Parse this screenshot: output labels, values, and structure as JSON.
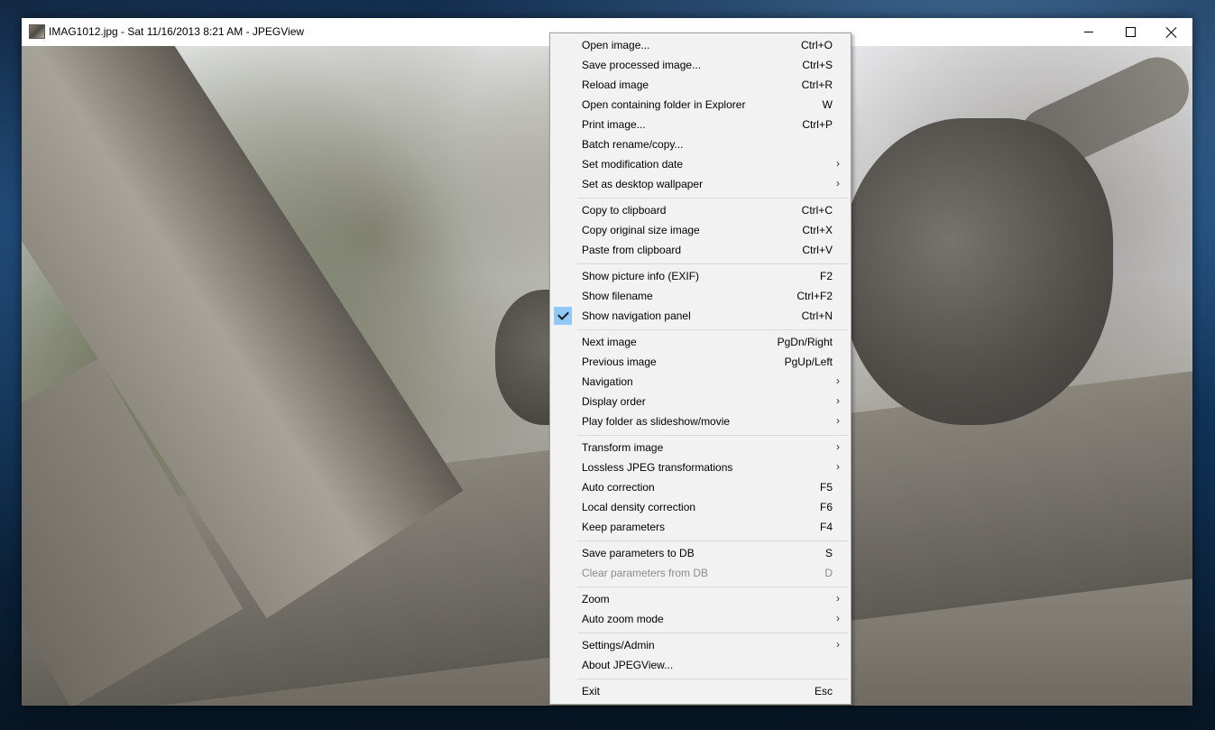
{
  "window": {
    "title": "IMAG1012.jpg - Sat 11/16/2013 8:21 AM - JPEGView"
  },
  "menu": {
    "items": [
      {
        "label": "Open image...",
        "shortcut": "Ctrl+O"
      },
      {
        "label": "Save processed image...",
        "shortcut": "Ctrl+S"
      },
      {
        "label": "Reload image",
        "shortcut": "Ctrl+R"
      },
      {
        "label": "Open containing folder in Explorer",
        "shortcut": "W"
      },
      {
        "label": "Print image...",
        "shortcut": "Ctrl+P"
      },
      {
        "label": "Batch rename/copy...",
        "shortcut": ""
      },
      {
        "label": "Set modification date",
        "shortcut": ""
      },
      {
        "label": "Set as desktop wallpaper",
        "shortcut": ""
      },
      {
        "label": "Copy to clipboard",
        "shortcut": "Ctrl+C"
      },
      {
        "label": "Copy original size image",
        "shortcut": "Ctrl+X"
      },
      {
        "label": "Paste from clipboard",
        "shortcut": "Ctrl+V"
      },
      {
        "label": "Show picture info (EXIF)",
        "shortcut": "F2"
      },
      {
        "label": "Show filename",
        "shortcut": "Ctrl+F2"
      },
      {
        "label": "Show navigation panel",
        "shortcut": "Ctrl+N",
        "checked": true
      },
      {
        "label": "Next image",
        "shortcut": "PgDn/Right"
      },
      {
        "label": "Previous image",
        "shortcut": "PgUp/Left"
      },
      {
        "label": "Navigation",
        "shortcut": ""
      },
      {
        "label": "Display order",
        "shortcut": ""
      },
      {
        "label": "Play folder as slideshow/movie",
        "shortcut": ""
      },
      {
        "label": "Transform image",
        "shortcut": ""
      },
      {
        "label": "Lossless JPEG transformations",
        "shortcut": ""
      },
      {
        "label": "Auto correction",
        "shortcut": "F5"
      },
      {
        "label": "Local density correction",
        "shortcut": "F6"
      },
      {
        "label": "Keep parameters",
        "shortcut": "F4"
      },
      {
        "label": "Save parameters to DB",
        "shortcut": "S"
      },
      {
        "label": "Clear parameters from DB",
        "shortcut": "D",
        "disabled": true
      },
      {
        "label": "Zoom",
        "shortcut": ""
      },
      {
        "label": "Auto zoom mode",
        "shortcut": ""
      },
      {
        "label": "Settings/Admin",
        "shortcut": ""
      },
      {
        "label": "About JPEGView...",
        "shortcut": ""
      },
      {
        "label": "Exit",
        "shortcut": "Esc"
      }
    ],
    "submenu_arrow": "›"
  }
}
